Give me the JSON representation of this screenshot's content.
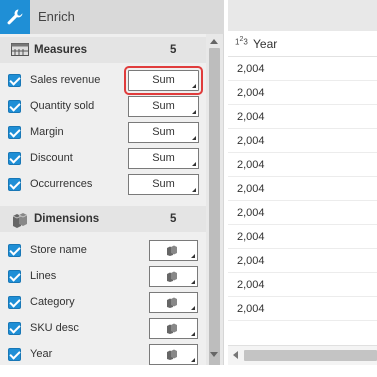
{
  "panel": {
    "title": "Enrich",
    "measures": {
      "title": "Measures",
      "count": "5",
      "items": [
        {
          "label": "Sales revenue",
          "aggregation": "Sum",
          "highlight": true
        },
        {
          "label": "Quantity sold",
          "aggregation": "Sum",
          "highlight": false
        },
        {
          "label": "Margin",
          "aggregation": "Sum",
          "highlight": false
        },
        {
          "label": "Discount",
          "aggregation": "Sum",
          "highlight": false
        },
        {
          "label": "Occurrences",
          "aggregation": "Sum",
          "highlight": false
        }
      ]
    },
    "dimensions": {
      "title": "Dimensions",
      "count": "5",
      "items": [
        {
          "label": "Store name"
        },
        {
          "label": "Lines"
        },
        {
          "label": "Category"
        },
        {
          "label": "SKU desc"
        },
        {
          "label": "Year"
        }
      ]
    }
  },
  "table": {
    "column": {
      "type_indicator": "123",
      "name": "Year"
    },
    "values": [
      "2,004",
      "2,004",
      "2,004",
      "2,004",
      "2,004",
      "2,004",
      "2,004",
      "2,004",
      "2,004",
      "2,004",
      "2,004"
    ]
  },
  "colors": {
    "accent": "#1f8fd6",
    "highlight": "#e03c3c"
  },
  "icons": {
    "enrich": "wrench-icon",
    "measures": "ruler-icon",
    "dimensions": "cubes-icon"
  }
}
